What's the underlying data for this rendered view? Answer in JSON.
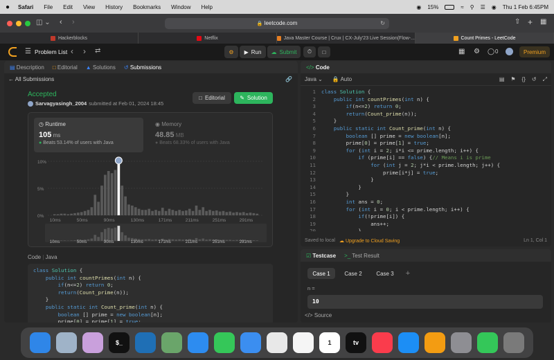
{
  "menubar": {
    "app": "Safari",
    "items": [
      "File",
      "Edit",
      "View",
      "History",
      "Bookmarks",
      "Window",
      "Help"
    ],
    "battery": "15%",
    "clock": "Thu 1 Feb  6:45PM"
  },
  "browser": {
    "url": "leetcode.com",
    "tabs": [
      {
        "label": "Hackerblocks",
        "color": "#c0392b"
      },
      {
        "label": "Netflix",
        "color": "#e50914"
      },
      {
        "label": "Java Master Course | Crux | CX-July'23 Live Session(Flow-...",
        "color": "#e67e22"
      },
      {
        "label": "Count Primes - LeetCode",
        "color": "#f0a020"
      }
    ]
  },
  "header": {
    "problem_list": "Problem List",
    "run": "Run",
    "submit": "Submit",
    "streak": "0",
    "premium": "Premium"
  },
  "left": {
    "tabs": [
      "Description",
      "Editorial",
      "Solutions",
      "Submissions"
    ],
    "back": "All Submissions",
    "status": "Accepted",
    "user": "Sarvagyasingh_2004",
    "submitted": "submitted at Feb 01, 2024 18:45",
    "editorial_btn": "Editorial",
    "solution_btn": "Solution",
    "runtime_label": "Runtime",
    "runtime_value": "105",
    "runtime_unit": "ms",
    "runtime_beats": "Beats 53.14% of users with Java",
    "memory_label": "Memory",
    "memory_value": "48.85",
    "memory_unit": "MB",
    "memory_beats": "Beats 68.33% of users with Java",
    "code_label": "Code",
    "lang_label": "Java",
    "code_lines": [
      "class Solution {",
      "    public int countPrimes(int n) {",
      "        if(n<=2) return 0;",
      "        return(Count_prime(n));",
      "    }",
      "    public static int Count_prime(int n) {",
      "        boolean [] prime = new boolean[n];",
      "        prime[0] = prime[1] = true;"
    ]
  },
  "chart_data": {
    "type": "bar",
    "title": "",
    "ylabel": "",
    "xlabel": "",
    "y_ticks": [
      "10%",
      "5%",
      "0%"
    ],
    "ylim": [
      0,
      10
    ],
    "x_ticks": [
      "10ms",
      "50ms",
      "90ms",
      "130ms",
      "171ms",
      "211ms",
      "251ms",
      "291ms"
    ],
    "xlim": [
      0,
      320
    ],
    "bin_width": 5,
    "x": [
      10,
      15,
      20,
      25,
      30,
      35,
      40,
      45,
      50,
      55,
      60,
      65,
      70,
      75,
      80,
      85,
      90,
      95,
      100,
      105,
      110,
      115,
      120,
      125,
      130,
      135,
      140,
      145,
      150,
      155,
      160,
      165,
      170,
      175,
      180,
      185,
      190,
      195,
      200,
      205,
      210,
      215,
      220,
      225,
      230,
      235,
      240,
      245,
      250,
      255,
      260,
      265,
      270,
      275,
      280,
      285,
      290,
      295,
      300,
      305,
      310
    ],
    "values": [
      0.2,
      0.2,
      0.3,
      0.3,
      0.2,
      0.3,
      0.4,
      0.5,
      0.6,
      0.8,
      1.0,
      1.5,
      3.8,
      2.5,
      5.5,
      7.5,
      8.2,
      7.8,
      8.4,
      9.5,
      5.5,
      3.5,
      2.0,
      1.8,
      1.5,
      1.2,
      1.0,
      1.0,
      1.2,
      0.8,
      1.0,
      0.8,
      1.4,
      0.8,
      1.2,
      1.0,
      0.8,
      1.0,
      0.8,
      0.9,
      1.2,
      0.8,
      1.8,
      1.0,
      1.5,
      0.8,
      1.0,
      0.8,
      0.9,
      0.7,
      0.8,
      0.6,
      0.7,
      0.5,
      0.6,
      0.5,
      0.6,
      0.4,
      0.5,
      0.4,
      0.3
    ],
    "highlight_x": 105
  },
  "right": {
    "title": "Code",
    "lang": "Java",
    "mode": "Auto",
    "saved": "Saved to local",
    "upgrade": "Upgrade to Cloud Saving",
    "cursor": "Ln 1, Col 1",
    "lines": [
      "class Solution {",
      "    public int countPrimes(int n) {",
      "        if(n<=2) return 0;",
      "        return(Count_prime(n));",
      "    }",
      "    public static int Count_prime(int n) {",
      "        boolean [] prime = new boolean[n];",
      "        prime[0] = prime[1] = true;",
      "        for (int i = 2; i*i <= prime.length; i++) {",
      "            if (prime[i] == false) {// Means i is prime",
      "                for (int j = 2; j*i < prime.length; j++) {",
      "                    prime[i*j] = true;",
      "                }",
      "            }",
      "        }",
      "        int ans = 0;",
      "        for (int i = 0; i < prime.length; i++) {",
      "            if(!prime[i]) {",
      "                ans++;",
      "            }"
    ]
  },
  "test": {
    "tab_testcase": "Testcase",
    "tab_result": "Test Result",
    "cases": [
      "Case 1",
      "Case 2",
      "Case 3"
    ],
    "add": "+",
    "var": "n =",
    "value": "10",
    "source": "Source"
  },
  "dock": [
    {
      "name": "finder",
      "color": "#2f86e8",
      "glyph": ""
    },
    {
      "name": "preview",
      "color": "#9fb3c8",
      "glyph": ""
    },
    {
      "name": "launchpad",
      "color": "#c9a0dc",
      "glyph": ""
    },
    {
      "name": "terminal",
      "color": "#111111",
      "glyph": "$_"
    },
    {
      "name": "vscode",
      "color": "#1f6fb5",
      "glyph": ""
    },
    {
      "name": "maps",
      "color": "#6aa56a",
      "glyph": ""
    },
    {
      "name": "safari",
      "color": "#2d8cf0",
      "glyph": ""
    },
    {
      "name": "messages",
      "color": "#35c759",
      "glyph": ""
    },
    {
      "name": "mail",
      "color": "#3b8ef0",
      "glyph": ""
    },
    {
      "name": "chrome",
      "color": "#e8e8e8",
      "glyph": ""
    },
    {
      "name": "photos",
      "color": "#f5f5f5",
      "glyph": ""
    },
    {
      "name": "calendar",
      "color": "#ffffff",
      "glyph": "1"
    },
    {
      "name": "appletv",
      "color": "#111111",
      "glyph": "tv"
    },
    {
      "name": "music",
      "color": "#fa3c4c",
      "glyph": ""
    },
    {
      "name": "appstore",
      "color": "#1c8ef5",
      "glyph": ""
    },
    {
      "name": "pages",
      "color": "#f39c12",
      "glyph": ""
    },
    {
      "name": "settings",
      "color": "#8e8e93",
      "glyph": ""
    },
    {
      "name": "facetime",
      "color": "#34c759",
      "glyph": ""
    },
    {
      "name": "trash",
      "color": "#7a7a7a",
      "glyph": ""
    }
  ]
}
